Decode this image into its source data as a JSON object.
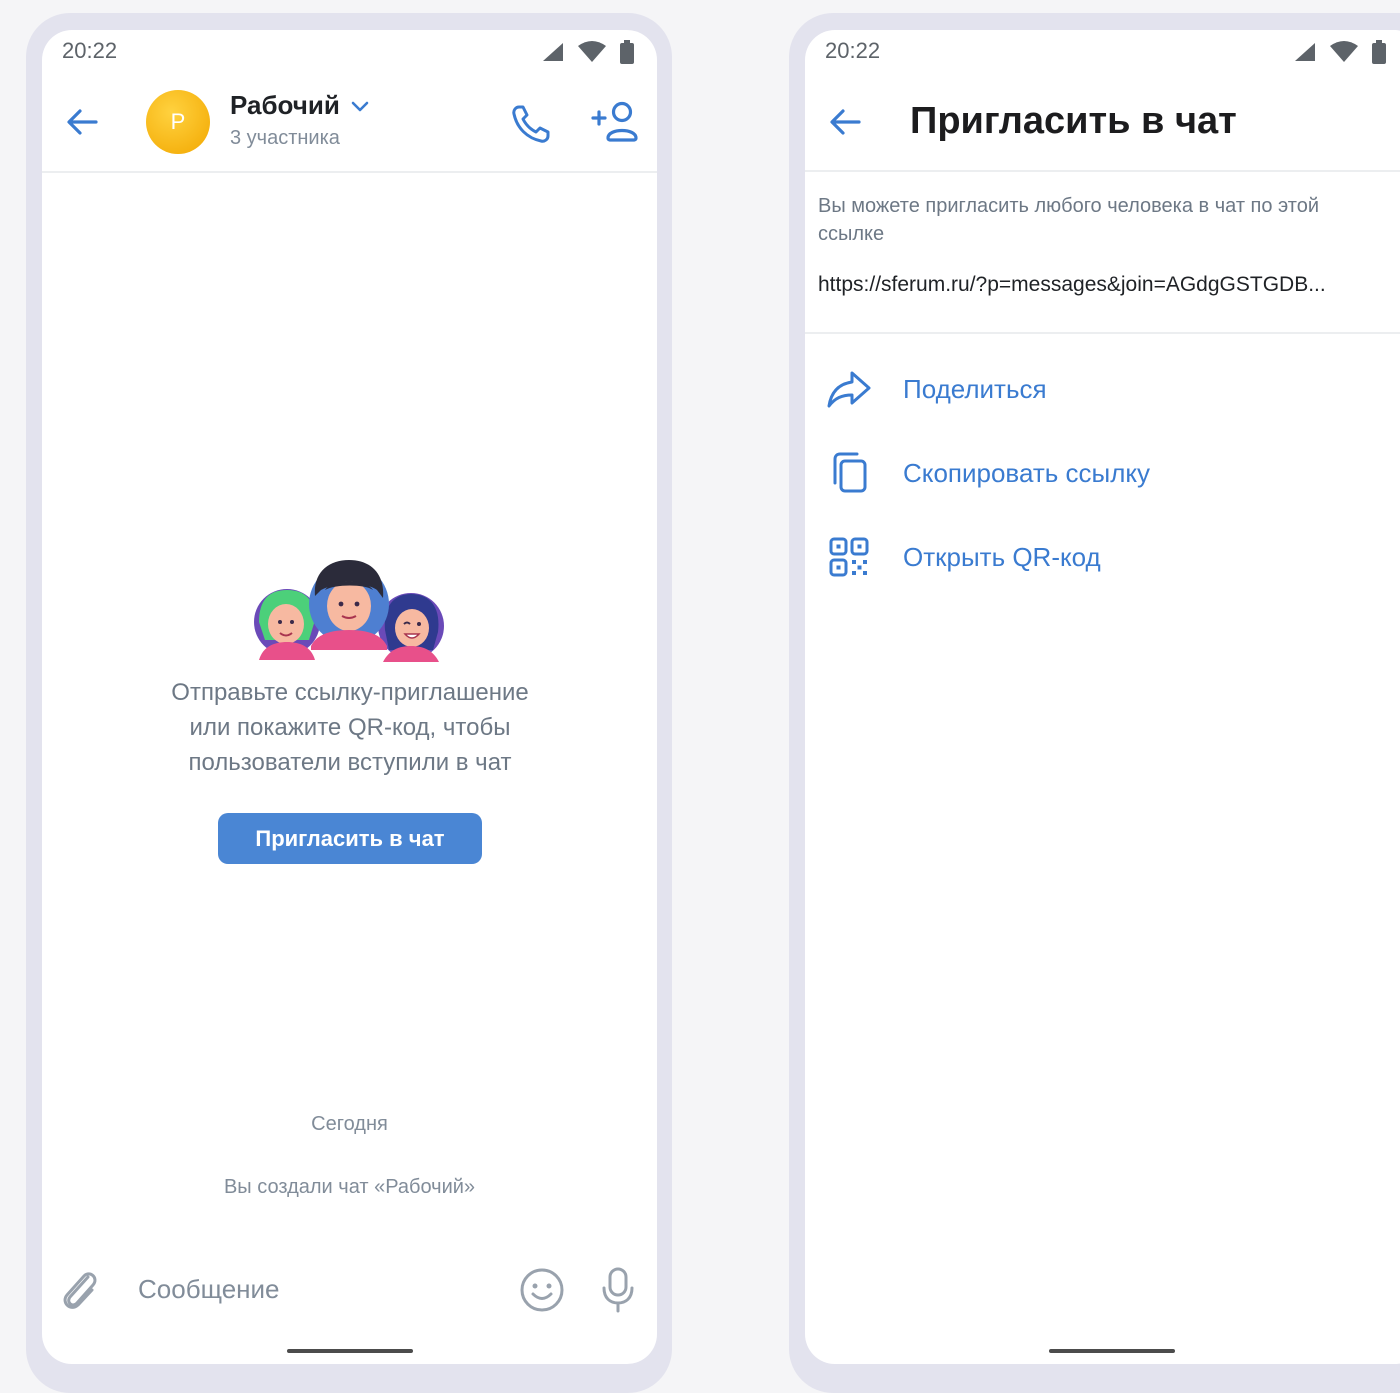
{
  "left": {
    "status": {
      "time": "20:22"
    },
    "header": {
      "title": "Рабочий",
      "avatar_letter": "Р",
      "subtitle": "3 участника"
    },
    "empty_state": {
      "text_lines": [
        "Отправьте ссылку-приглашение",
        "или покажите QR-код, чтобы",
        "пользователи вступили в чат"
      ],
      "button_label": "Пригласить в чат"
    },
    "timeline": {
      "date": "Сегодня",
      "event": "Вы создали чат «Рабочий»"
    },
    "composer": {
      "placeholder": "Сообщение"
    }
  },
  "right": {
    "status": {
      "time": "20:22"
    },
    "header": {
      "title": "Пригласить в чат"
    },
    "description": "Вы можете пригласить любого человека в чат по этой ссылке",
    "link": "https://sferum.ru/?p=messages&join=AGdgGSTGDB...",
    "actions": [
      {
        "label": "Поделиться",
        "icon": "share-icon"
      },
      {
        "label": "Скопировать ссылку",
        "icon": "copy-icon"
      },
      {
        "label": "Открыть QR-код",
        "icon": "qr-code-icon"
      }
    ]
  },
  "colors": {
    "accent": "#3a7bd0",
    "button": "#4a86d4",
    "avatar": "#f5b400",
    "secondary_text": "#818c99",
    "frame": "#e3e3ee"
  }
}
